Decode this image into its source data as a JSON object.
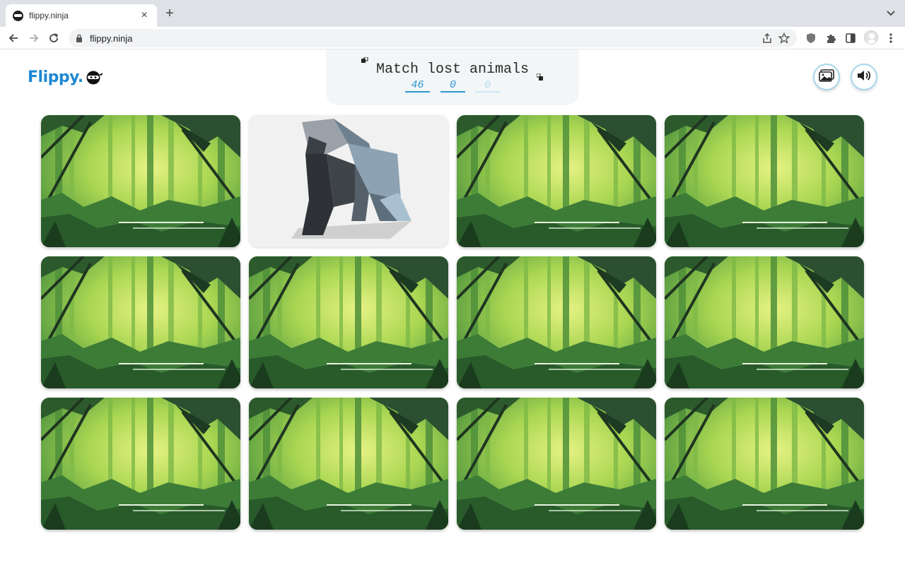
{
  "browser": {
    "tab_title": "flippy.ninja",
    "url": "flippy.ninja"
  },
  "logo": {
    "text": "Flippy."
  },
  "game": {
    "title": "Match lost animals",
    "stats": [
      "46",
      "0",
      "0"
    ]
  },
  "buttons": {
    "image_icon": "image-icon",
    "sound_icon": "speaker-icon"
  },
  "board": {
    "rows": 3,
    "columns": 4,
    "cards": [
      {
        "state": "hidden"
      },
      {
        "state": "revealed",
        "animal": "gorilla"
      },
      {
        "state": "hidden"
      },
      {
        "state": "hidden"
      },
      {
        "state": "hidden"
      },
      {
        "state": "hidden"
      },
      {
        "state": "hidden"
      },
      {
        "state": "hidden"
      },
      {
        "state": "hidden"
      },
      {
        "state": "hidden"
      },
      {
        "state": "hidden"
      },
      {
        "state": "hidden"
      }
    ]
  },
  "colors": {
    "brand_blue": "#1e88d3",
    "stat_blue": "#2e97d3",
    "jungle_light": "#c9e46a",
    "jungle_dark": "#1f4a2a"
  }
}
